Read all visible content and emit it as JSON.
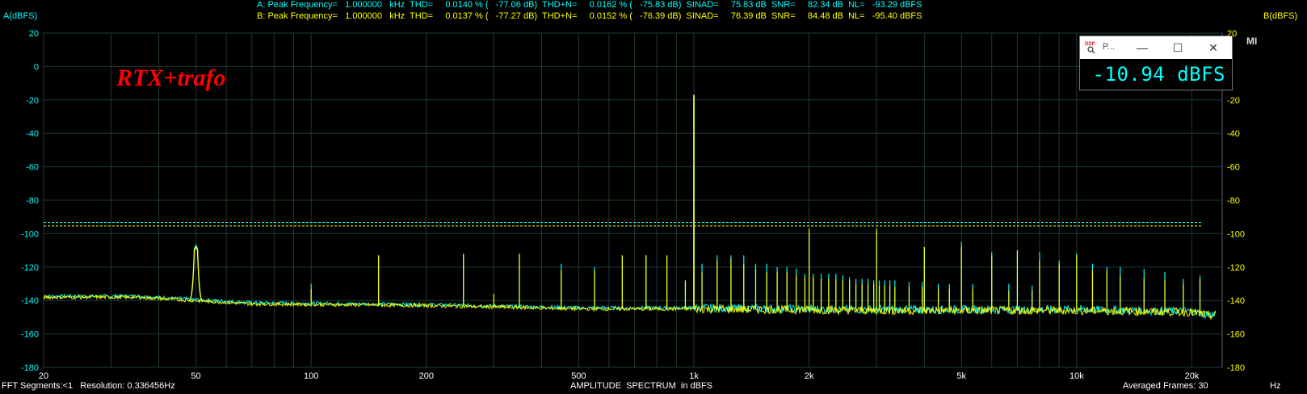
{
  "header": {
    "a_line": "A: Peak Frequency=   1.000000   kHz  THD=     0.0140 % (   -77.06 dB)  THD+N=     0.0162 % (   -75.83 dB)  SINAD=     75.83 dB  SNR=     82.34 dB  NL=   -93.29 dBFS",
    "b_line": "B: Peak Frequency=   1.000000   kHz  THD=     0.0137 % (   -77.27 dB)  THD+N=     0.0152 % (   -76.39 dB)  SINAD=     76.39 dB  SNR=     84.48 dB  NL=   -95.40 dBFS"
  },
  "labels": {
    "left_axis": "A(dBFS)",
    "right_axis": "B(dBFS)",
    "brand": "RTX+trafo",
    "footer_left": "FFT Segments:<1   Resolution: 0.336456Hz",
    "footer_center": "AMPLITUDE  SPECTRUM  in dBFS",
    "footer_right": "Averaged Frames: 30",
    "footer_unit": "Hz",
    "corner_mark": "MI"
  },
  "popup": {
    "title": "P...",
    "value": "-10.94  dBFS",
    "minimize": "—",
    "maximize": "☐",
    "close": "✕",
    "logo_icon": "ddp-logo-icon"
  },
  "colors": {
    "background": "#000000",
    "grid": "#1e3a3a",
    "channel_a": "#00ffff",
    "channel_b": "#ffff00",
    "text_a": "#00ffff",
    "text_b": "#ffff00",
    "brand": "#ff0000"
  },
  "chart_data": {
    "type": "line",
    "title": "AMPLITUDE  SPECTRUM  in dBFS",
    "xlabel": "Hz",
    "ylabel": "A(dBFS)",
    "ylabel_right": "B(dBFS)",
    "x_scale": "log",
    "xlim": [
      20,
      24000
    ],
    "ylim": [
      -180,
      20
    ],
    "x_ticks": [
      20,
      50,
      100,
      200,
      500,
      1000,
      2000,
      5000,
      10000,
      20000
    ],
    "x_tick_labels": [
      "20",
      "50",
      "100",
      "200",
      "500",
      "1k",
      "2k",
      "5k",
      "10k",
      "20k"
    ],
    "y_ticks": [
      20,
      0,
      -20,
      -40,
      -60,
      -80,
      -100,
      -120,
      -140,
      -160,
      -180
    ],
    "grid": true,
    "noise_floor": [
      [
        20,
        -138
      ],
      [
        35,
        -138
      ],
      [
        70,
        -142
      ],
      [
        200,
        -143
      ],
      [
        500,
        -145
      ],
      [
        1000,
        -145
      ],
      [
        3000,
        -146
      ],
      [
        10000,
        -146
      ],
      [
        20000,
        -147
      ],
      [
        22000,
        -149
      ]
    ],
    "noise_level_lines": {
      "A": -93.29,
      "B": -95.4
    },
    "series": [
      {
        "name": "A",
        "peaks": [
          [
            50,
            -107
          ],
          [
            100,
            -130
          ],
          [
            150,
            -113
          ],
          [
            250,
            -113
          ],
          [
            350,
            -112
          ],
          [
            450,
            -118
          ],
          [
            550,
            -120
          ],
          [
            650,
            -113
          ],
          [
            750,
            -113
          ],
          [
            850,
            -113
          ],
          [
            950,
            -128
          ],
          [
            1000,
            -17
          ],
          [
            1050,
            -118
          ],
          [
            1150,
            -113
          ],
          [
            1250,
            -113
          ],
          [
            1350,
            -113
          ],
          [
            1450,
            -118
          ],
          [
            1550,
            -118
          ],
          [
            1650,
            -120
          ],
          [
            1750,
            -120
          ],
          [
            1850,
            -121
          ],
          [
            1950,
            -124
          ],
          [
            2000,
            -100
          ],
          [
            2050,
            -124
          ],
          [
            2150,
            -124
          ],
          [
            2250,
            -124
          ],
          [
            2350,
            -124
          ],
          [
            2450,
            -125
          ],
          [
            2550,
            -126
          ],
          [
            2650,
            -127
          ],
          [
            2750,
            -127
          ],
          [
            2850,
            -127
          ],
          [
            2950,
            -128
          ],
          [
            3000,
            -99
          ],
          [
            3050,
            -128
          ],
          [
            3150,
            -128
          ],
          [
            3250,
            -128
          ],
          [
            3350,
            -128
          ],
          [
            3650,
            -129
          ],
          [
            3950,
            -129
          ],
          [
            4000,
            -108
          ],
          [
            4350,
            -130
          ],
          [
            4650,
            -130
          ],
          [
            5000,
            -105
          ],
          [
            5350,
            -130
          ],
          [
            6000,
            -111
          ],
          [
            6650,
            -130
          ],
          [
            7000,
            -110
          ],
          [
            7650,
            -131
          ],
          [
            8000,
            -111
          ],
          [
            9000,
            -116
          ],
          [
            10000,
            -112
          ],
          [
            11000,
            -118
          ],
          [
            12000,
            -120
          ],
          [
            13000,
            -120
          ],
          [
            15000,
            -121
          ],
          [
            17000,
            -123
          ],
          [
            19000,
            -127
          ],
          [
            21000,
            -125
          ]
        ]
      },
      {
        "name": "B",
        "peaks": [
          [
            50,
            -108
          ],
          [
            100,
            -133
          ],
          [
            150,
            -113
          ],
          [
            250,
            -112
          ],
          [
            300,
            -136
          ],
          [
            350,
            -112
          ],
          [
            450,
            -122
          ],
          [
            550,
            -122
          ],
          [
            650,
            -113
          ],
          [
            750,
            -113
          ],
          [
            850,
            -113
          ],
          [
            950,
            -128
          ],
          [
            1000,
            -17
          ],
          [
            1050,
            -123
          ],
          [
            1150,
            -116
          ],
          [
            1250,
            -115
          ],
          [
            1350,
            -118
          ],
          [
            1450,
            -121
          ],
          [
            1550,
            -123
          ],
          [
            1650,
            -123
          ],
          [
            1750,
            -123
          ],
          [
            1850,
            -125
          ],
          [
            1950,
            -126
          ],
          [
            2000,
            -97
          ],
          [
            2050,
            -126
          ],
          [
            2150,
            -127
          ],
          [
            2250,
            -127
          ],
          [
            2350,
            -127
          ],
          [
            2450,
            -128
          ],
          [
            2550,
            -128
          ],
          [
            2650,
            -130
          ],
          [
            2750,
            -130
          ],
          [
            2850,
            -130
          ],
          [
            2950,
            -130
          ],
          [
            3000,
            -97
          ],
          [
            3050,
            -131
          ],
          [
            3150,
            -131
          ],
          [
            3250,
            -131
          ],
          [
            3350,
            -132
          ],
          [
            3650,
            -132
          ],
          [
            3950,
            -132
          ],
          [
            4000,
            -108
          ],
          [
            4350,
            -133
          ],
          [
            4650,
            -133
          ],
          [
            5000,
            -108
          ],
          [
            5350,
            -133
          ],
          [
            6000,
            -113
          ],
          [
            6650,
            -134
          ],
          [
            7000,
            -110
          ],
          [
            7650,
            -134
          ],
          [
            8000,
            -116
          ],
          [
            9000,
            -118
          ],
          [
            10000,
            -113
          ],
          [
            11000,
            -122
          ],
          [
            12000,
            -122
          ],
          [
            13000,
            -125
          ],
          [
            15000,
            -127
          ],
          [
            17000,
            -128
          ],
          [
            19000,
            -130
          ],
          [
            21000,
            -127
          ]
        ]
      }
    ]
  }
}
